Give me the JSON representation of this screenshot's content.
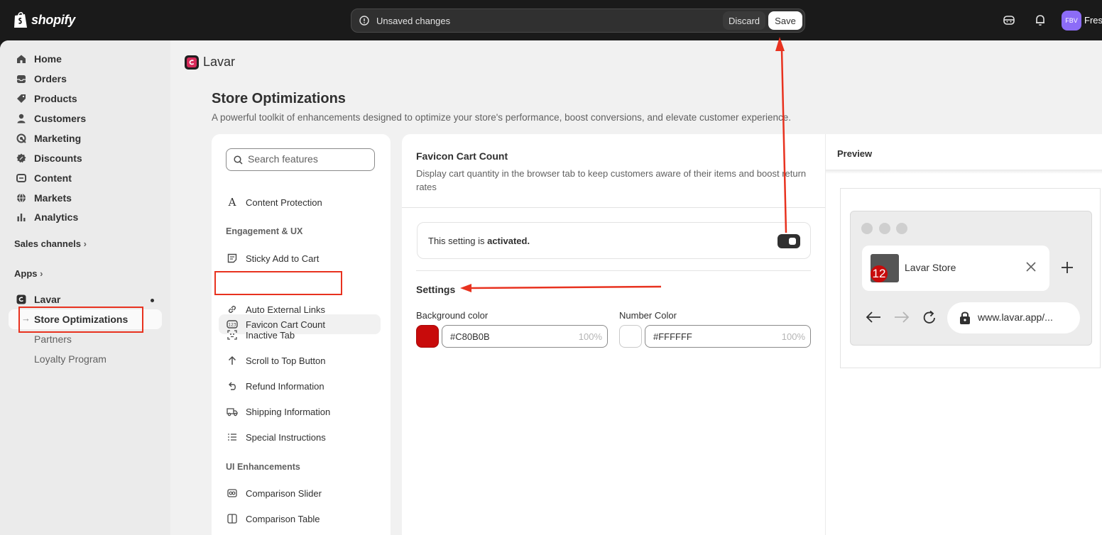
{
  "topbar": {
    "brand": "shopify",
    "unsaved_message": "Unsaved changes",
    "discard_label": "Discard",
    "save_label": "Save",
    "avatar_initials": "FBV",
    "user_name": "Fres"
  },
  "sidebar": {
    "items": [
      {
        "label": "Home",
        "icon": "home-icon"
      },
      {
        "label": "Orders",
        "icon": "orders-icon"
      },
      {
        "label": "Products",
        "icon": "tag-icon"
      },
      {
        "label": "Customers",
        "icon": "person-icon"
      },
      {
        "label": "Marketing",
        "icon": "target-icon"
      },
      {
        "label": "Discounts",
        "icon": "discount-icon"
      },
      {
        "label": "Content",
        "icon": "content-icon"
      },
      {
        "label": "Markets",
        "icon": "globe-icon"
      },
      {
        "label": "Analytics",
        "icon": "bar-chart-icon"
      }
    ],
    "sales_channels_label": "Sales channels",
    "apps_label": "Apps",
    "app_name": "Lavar",
    "app_subitems": {
      "active": "Store Optimizations",
      "partners": "Partners",
      "loyalty": "Loyalty Program"
    }
  },
  "main": {
    "app_title": "Lavar",
    "page_title": "Store Optimizations",
    "page_subtitle": "A powerful toolkit of enhancements designed to optimize your store's performance, boost conversions, and elevate customer experience."
  },
  "features": {
    "search_placeholder": "Search features",
    "top_item": "Content Protection",
    "engagement_header": "Engagement & UX",
    "engagement_items": [
      "Sticky Add to Cart",
      "Favicon Cart Count",
      "Auto External Links",
      "Inactive Tab",
      "Scroll to Top Button",
      "Refund Information",
      "Shipping Information",
      "Special Instructions"
    ],
    "ui_header": "UI Enhancements",
    "ui_items": [
      "Comparison Slider",
      "Comparison Table"
    ],
    "selected": "Favicon Cart Count"
  },
  "detail": {
    "title": "Favicon Cart Count",
    "description": "Display cart quantity in the browser tab to keep customers aware of their items and boost return rates",
    "status_prefix": "This setting is ",
    "status_value": "activated.",
    "toggle_on": true,
    "settings_header": "Settings",
    "background_color_label": "Background color",
    "background_color_value": "#C80B0B",
    "background_opacity": "100%",
    "number_color_label": "Number Color",
    "number_color_value": "#FFFFFF",
    "number_opacity": "100%"
  },
  "preview": {
    "header": "Preview",
    "badge_count": "12",
    "tab_title": "Lavar Store",
    "url": "www.lavar.app/..."
  },
  "colors": {
    "topbar": "#1a1a1a",
    "annotation": "#e8321f",
    "badge": "#C80B0B",
    "avatar": "#8c6cf7"
  }
}
